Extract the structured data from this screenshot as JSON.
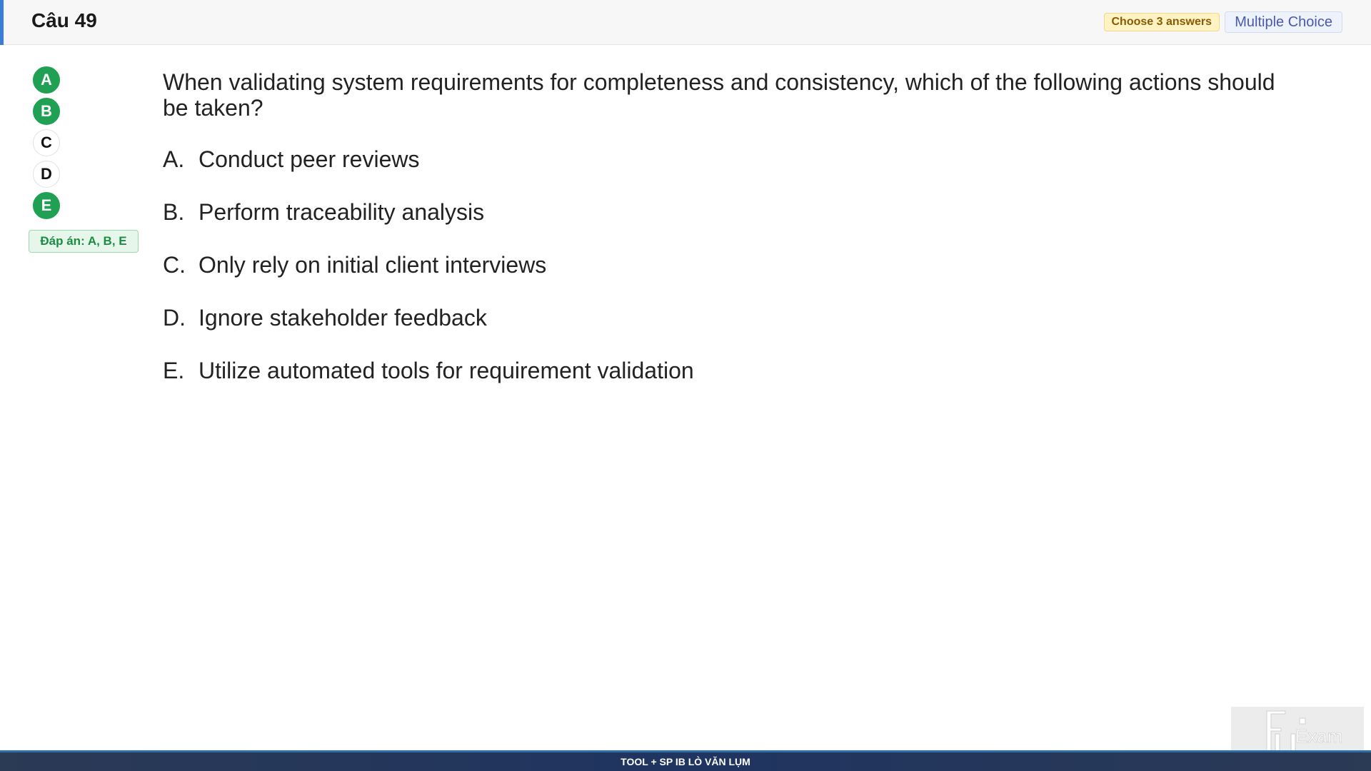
{
  "header": {
    "title": "Câu 49",
    "choose_badge": "Choose 3 answers",
    "type_badge": "Multiple Choice"
  },
  "answer_indicators": [
    {
      "letter": "A",
      "selected": true
    },
    {
      "letter": "B",
      "selected": true
    },
    {
      "letter": "C",
      "selected": false
    },
    {
      "letter": "D",
      "selected": false
    },
    {
      "letter": "E",
      "selected": true
    }
  ],
  "answer_key": "Đáp án: A, B, E",
  "question": {
    "text": "When validating system requirements for completeness and consistency, which of the following actions should be taken?",
    "options": [
      {
        "letter": "A.",
        "text": "Conduct peer reviews"
      },
      {
        "letter": "B.",
        "text": "Perform traceability analysis"
      },
      {
        "letter": "C.",
        "text": "Only rely on initial client interviews"
      },
      {
        "letter": "D.",
        "text": "Ignore stakeholder feedback"
      },
      {
        "letter": "E.",
        "text": "Utilize automated tools for requirement validation"
      }
    ]
  },
  "logo": {
    "text": "Exam",
    "icon": "fu-exam-logo"
  },
  "footer": {
    "text": "TOOL + SP IB LÒ VĂN LỤM"
  },
  "colors": {
    "accent": "#3b7dd8",
    "selected_green": "#1fa052",
    "badge_yellow": "#fff3c4",
    "footer_bg": "#1f3460"
  }
}
